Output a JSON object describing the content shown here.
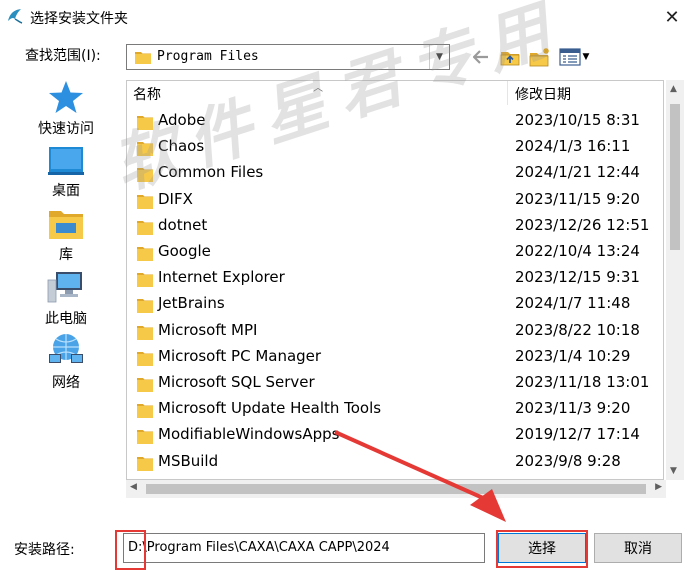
{
  "window": {
    "title": "选择安装文件夹"
  },
  "lookin": {
    "label": "查找范围(I):",
    "value": "Program Files"
  },
  "places": [
    {
      "label": "快速访问",
      "icon": "star-icon"
    },
    {
      "label": "桌面",
      "icon": "desktop-icon"
    },
    {
      "label": "库",
      "icon": "library-icon"
    },
    {
      "label": "此电脑",
      "icon": "computer-icon"
    },
    {
      "label": "网络",
      "icon": "network-icon"
    }
  ],
  "columns": {
    "name": "名称",
    "date": "修改日期"
  },
  "files": [
    {
      "name": "Adobe",
      "date": "2023/10/15 8:31"
    },
    {
      "name": "Chaos",
      "date": "2024/1/3 16:11"
    },
    {
      "name": "Common Files",
      "date": "2024/1/21 12:44"
    },
    {
      "name": "DIFX",
      "date": "2023/11/15 9:20"
    },
    {
      "name": "dotnet",
      "date": "2023/12/26 12:51"
    },
    {
      "name": "Google",
      "date": "2022/10/4 13:24"
    },
    {
      "name": "Internet Explorer",
      "date": "2023/12/15 9:31"
    },
    {
      "name": "JetBrains",
      "date": "2024/1/7 11:48"
    },
    {
      "name": "Microsoft MPI",
      "date": "2023/8/22 10:18"
    },
    {
      "name": "Microsoft PC Manager",
      "date": "2023/1/4 10:29"
    },
    {
      "name": "Microsoft SQL Server",
      "date": "2023/11/18 13:01"
    },
    {
      "name": "Microsoft Update Health Tools",
      "date": "2023/11/3 9:20"
    },
    {
      "name": "ModifiableWindowsApps",
      "date": "2019/12/7 17:14"
    },
    {
      "name": "MSBuild",
      "date": "2023/9/8 9:28"
    }
  ],
  "path": {
    "label": "安装路径:",
    "value": "D:\\Program Files\\CAXA\\CAXA CAPP\\2024"
  },
  "buttons": {
    "select": "选择",
    "cancel": "取消"
  },
  "watermark": {
    "text": "软件星君专用"
  },
  "colors": {
    "folder": "#f7c948",
    "folder_dark": "#e0a92c",
    "accent": "#0078d7",
    "annotation": "#e53935"
  }
}
